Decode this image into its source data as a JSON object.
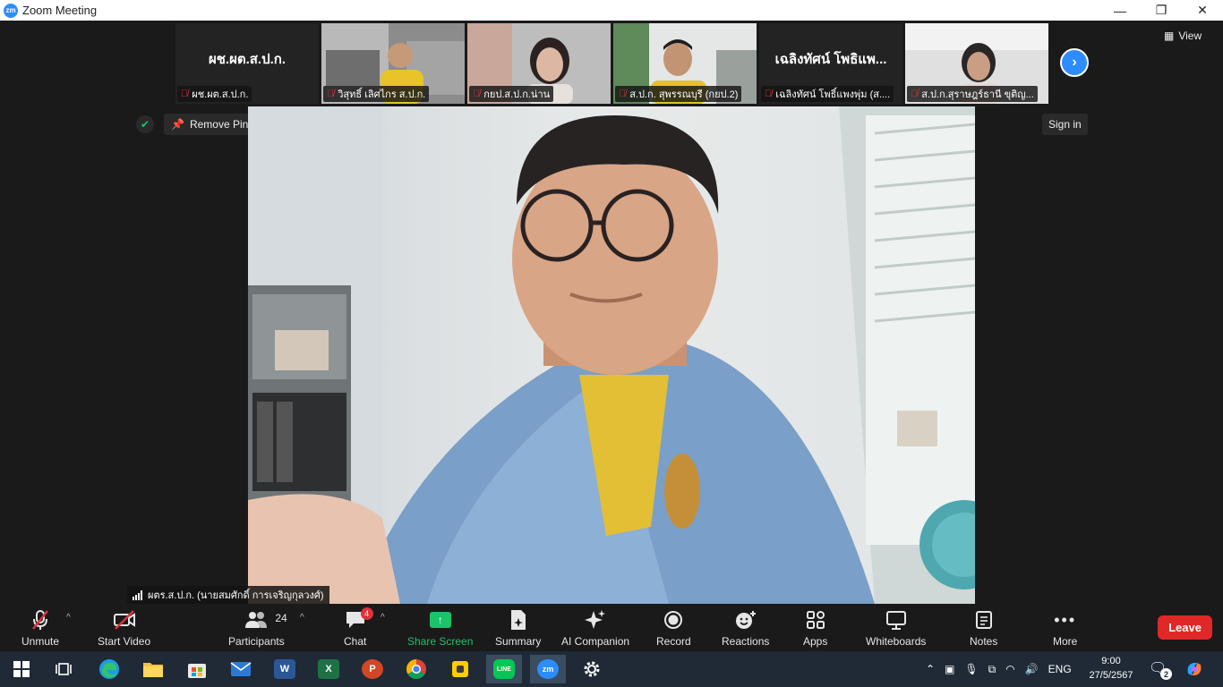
{
  "window": {
    "title": "Zoom Meeting",
    "logo_text": "zm",
    "minimize": "—",
    "restore": "❐",
    "close": "✕"
  },
  "gallery": {
    "participants": [
      {
        "big_name": "ผช.ผต.ส.ป.ก.",
        "label": "ผช.ผต.ส.ป.ก.",
        "video": false
      },
      {
        "big_name": "",
        "label": "วิสุทธิ์  เลิศไกร ส.ป.ก.",
        "video": true
      },
      {
        "big_name": "",
        "label": "กยป.ส.ป.ก.น่าน",
        "video": true
      },
      {
        "big_name": "",
        "label": "ส.ป.ก. สุพรรณบุรี (กยป.2)",
        "video": true
      },
      {
        "big_name": "เฉลิงทัศน์ โพธิแพ...",
        "label": "เฉลิงทัศน์ โพธิ์แพงพุ่ม (ส....",
        "video": false
      },
      {
        "big_name": "",
        "label": "ส.ป.ก.สุราษฎร์ธานี ขุติญ...",
        "video": true
      }
    ],
    "next_icon": "›",
    "view_label": "View"
  },
  "overlay": {
    "remove_pin": "Remove Pin",
    "sign_in": "Sign in"
  },
  "speaker": {
    "name": "ผตร.ส.ป.ก. (นายสมศักดิ์  การเจริญกุลวงศ์)"
  },
  "toolbar": {
    "unmute": "Unmute",
    "start_video": "Start Video",
    "participants": "Participants",
    "participants_count": "24",
    "chat": "Chat",
    "chat_badge": "4",
    "share_screen": "Share Screen",
    "summary": "Summary",
    "ai_companion": "AI Companion",
    "record": "Record",
    "reactions": "Reactions",
    "apps": "Apps",
    "whiteboards": "Whiteboards",
    "notes": "Notes",
    "more": "More",
    "leave": "Leave"
  },
  "taskbar": {
    "word": "W",
    "excel": "X",
    "powerpoint": "P",
    "line": "LINE",
    "zoom": "zm",
    "language": "ENG",
    "time": "9:00",
    "date": "27/5/2567",
    "notifications": "2"
  },
  "colors": {
    "accent": "#2d8cff",
    "leave": "#e02828",
    "share": "#1bc36b",
    "muted": "#e0313b"
  }
}
